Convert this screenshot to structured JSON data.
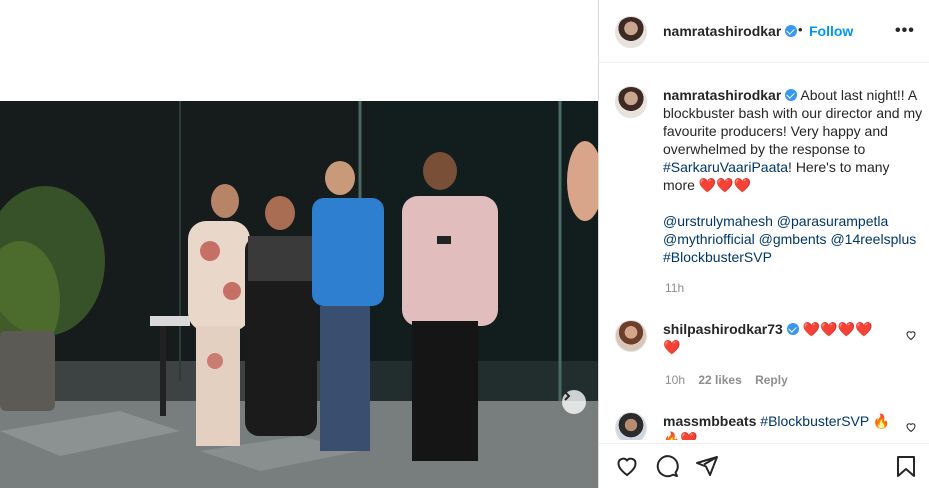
{
  "post": {
    "username": "namratashirodkar",
    "follow_label": "Follow",
    "separator": "•",
    "more_label": "•••",
    "caption_text": "About last night!! A blockbuster bash with our director and my favourite producers! Very happy and overwhelmed by the response to",
    "caption_hashtag": "#SarkaruVaariPaata",
    "caption_tail": "! Here's to many more",
    "caption_hearts": "❤️❤️❤️",
    "mentions": "@urstrulymahesh @parasurampetla @mythriofficial @gmbents @14reelsplus",
    "caption_hashtag2": "#BlockbusterSVP",
    "time": "11h"
  },
  "comments": [
    {
      "username": "shilpashirodkar73",
      "text": "❤️❤️❤️❤️",
      "text2": "❤️",
      "time": "10h",
      "likes": "22 likes",
      "reply": "Reply"
    },
    {
      "username": "massmbbeats",
      "text": "#BlockbusterSVP 🔥",
      "text2": "🔥❤️"
    }
  ],
  "colors": {
    "link_blue": "#0095f6",
    "hashtag": "#00376b",
    "verified": "#3897f0",
    "muted": "#8e8e8e"
  },
  "icons": [
    "verified-badge-icon",
    "heart-icon",
    "comment-icon",
    "share-icon",
    "bookmark-icon",
    "chevron-right-icon",
    "more-options-icon"
  ]
}
